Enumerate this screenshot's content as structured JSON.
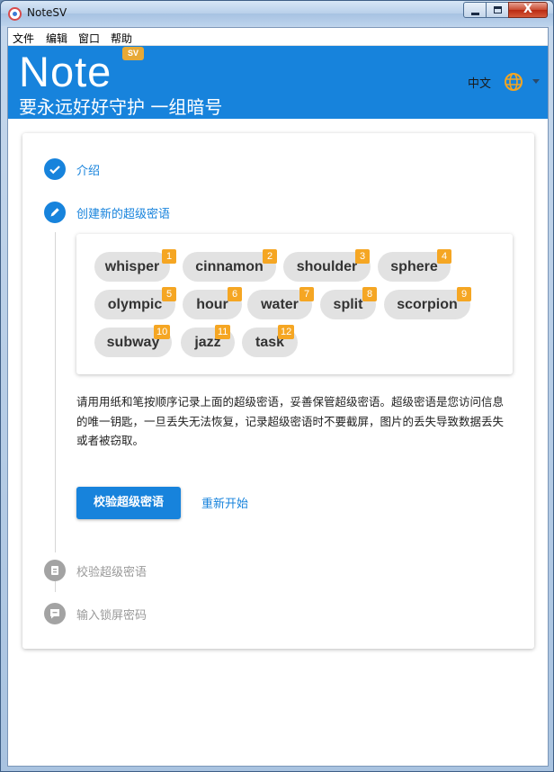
{
  "window": {
    "title": "NoteSV",
    "minimize_glyph": "",
    "maximize_glyph": "",
    "close_glyph": "X"
  },
  "menu": [
    "文件",
    "编辑",
    "窗口",
    "帮助"
  ],
  "header": {
    "brand": "Note",
    "badge": "SV",
    "slogan": "要永远好好守护 一组暗号",
    "language": "中文",
    "globe_icon": "globe-icon",
    "accent": "#1783dc"
  },
  "steps": [
    {
      "label": "介绍",
      "icon": "check-icon",
      "state": "done"
    },
    {
      "label": "创建新的超级密语",
      "icon": "pencil-icon",
      "state": "active"
    },
    {
      "label": "校验超级密语",
      "icon": "clipboard-icon",
      "state": "pending"
    },
    {
      "label": "输入锁屏密码",
      "icon": "chat-icon",
      "state": "pending"
    }
  ],
  "words": [
    {
      "word": "whisper",
      "n": "1"
    },
    {
      "word": "cinnamon",
      "n": "2"
    },
    {
      "word": "shoulder",
      "n": "3"
    },
    {
      "word": "sphere",
      "n": "4"
    },
    {
      "word": "olympic",
      "n": "5"
    },
    {
      "word": "hour",
      "n": "6"
    },
    {
      "word": "water",
      "n": "7"
    },
    {
      "word": "split",
      "n": "8"
    },
    {
      "word": "scorpion",
      "n": "9"
    },
    {
      "word": "subway",
      "n": "10"
    },
    {
      "word": "jazz",
      "n": "11"
    },
    {
      "word": "task",
      "n": "12"
    }
  ],
  "description": "请用用纸和笔按顺序记录上面的超级密语，妥善保管超级密语。超级密语是您访问信息的唯一钥匙，一旦丢失无法恢复，记录超级密语时不要截屏，图片的丢失导致数据丢失或者被窃取。",
  "actions": {
    "verify": "校验超级密语",
    "restart": "重新开始"
  }
}
